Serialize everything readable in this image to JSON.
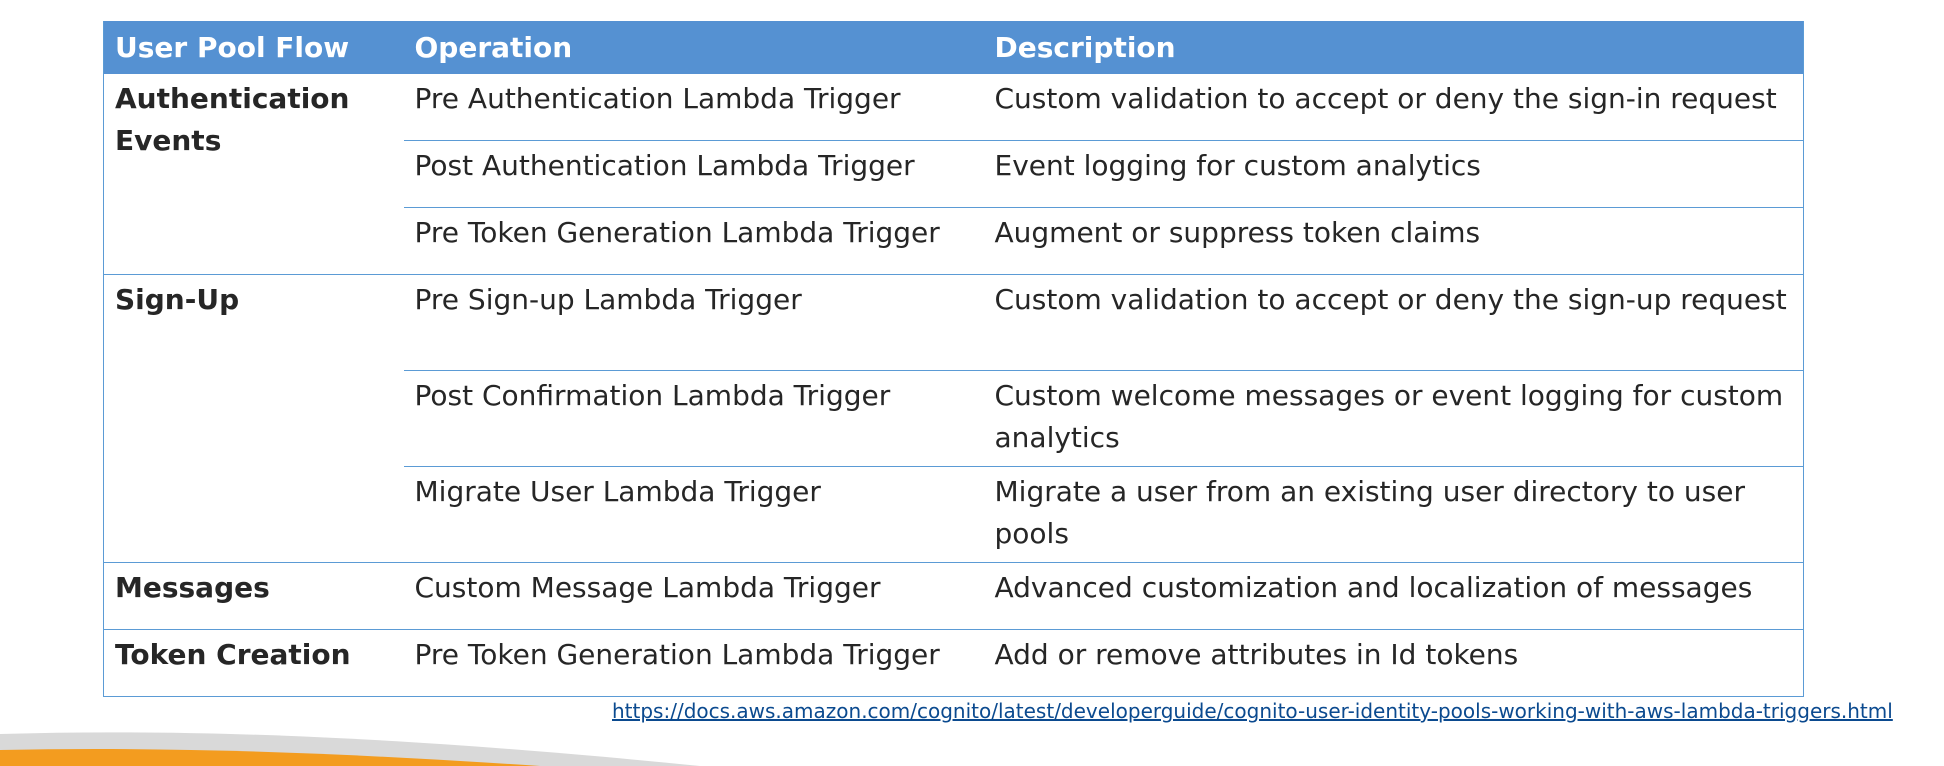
{
  "table": {
    "headers": [
      "User Pool Flow",
      "Operation",
      "Description"
    ],
    "groups": [
      {
        "flow": "Authentication Events",
        "rows": [
          {
            "operation": "Pre Authentication Lambda Trigger",
            "description": "Custom validation to accept or deny the sign-in request"
          },
          {
            "operation": "Post Authentication Lambda Trigger",
            "description": "Event logging for custom analytics"
          },
          {
            "operation": "Pre Token Generation Lambda Trigger",
            "description": "Augment or suppress token claims"
          }
        ]
      },
      {
        "flow": "Sign-Up",
        "rows": [
          {
            "operation": "Pre Sign-up Lambda Trigger",
            "description": "Custom validation to accept or deny the sign-up request"
          },
          {
            "operation": "Post Confirmation Lambda Trigger",
            "description": "Custom welcome messages or event logging for custom analytics"
          },
          {
            "operation": "Migrate User Lambda Trigger",
            "description": "Migrate a user from an existing user directory to user pools"
          }
        ]
      },
      {
        "flow": "Messages",
        "rows": [
          {
            "operation": "Custom Message Lambda Trigger",
            "description": "Advanced customization and localization of messages"
          }
        ]
      },
      {
        "flow": "Token Creation",
        "rows": [
          {
            "operation": "Pre Token Generation Lambda Trigger",
            "description": "Add or remove attributes in Id tokens"
          }
        ]
      }
    ]
  },
  "source_link": "https://docs.aws.amazon.com/cognito/latest/developerguide/cognito-user-identity-pools-working-with-aws-lambda-triggers.html",
  "colors": {
    "header_bg": "#5591d2",
    "grid_line": "#5b9bd5",
    "link": "#0b4a8f",
    "swoosh_orange": "#f39c1f",
    "swoosh_gray": "#d9d9d9"
  }
}
